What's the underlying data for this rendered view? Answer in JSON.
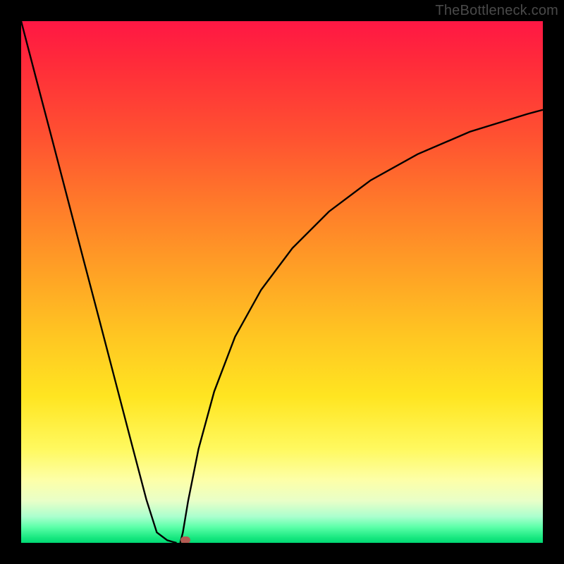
{
  "watermark": "TheBottleneck.com",
  "colors": {
    "frame": "#000000",
    "curve": "#000000",
    "marker": "#b35a52"
  },
  "chart_data": {
    "type": "line",
    "title": "",
    "xlabel": "",
    "ylabel": "",
    "x_range": [
      0,
      100
    ],
    "y_range": [
      0,
      100
    ],
    "curve_left": {
      "x": [
        0,
        3,
        6,
        9,
        12,
        15,
        18,
        21,
        24,
        26,
        28,
        29,
        29.8
      ],
      "y": [
        100,
        88.5,
        77.1,
        65.6,
        54.1,
        42.7,
        31.2,
        19.7,
        8.3,
        2.0,
        0.5,
        0.2,
        0.0
      ]
    },
    "curve_right": {
      "x": [
        30.5,
        31,
        32,
        34,
        37,
        41,
        46,
        52,
        59,
        67,
        76,
        86,
        97,
        100
      ],
      "y": [
        0.0,
        2.0,
        8.0,
        18.0,
        29.0,
        39.5,
        48.5,
        56.5,
        63.5,
        69.5,
        74.5,
        78.8,
        82.2,
        83.0
      ]
    },
    "cusp": {
      "x": 30,
      "y": 0
    },
    "marker": {
      "x": 31.5,
      "y": 0.5
    },
    "background_gradient": "red-yellow-green (top to bottom)"
  }
}
